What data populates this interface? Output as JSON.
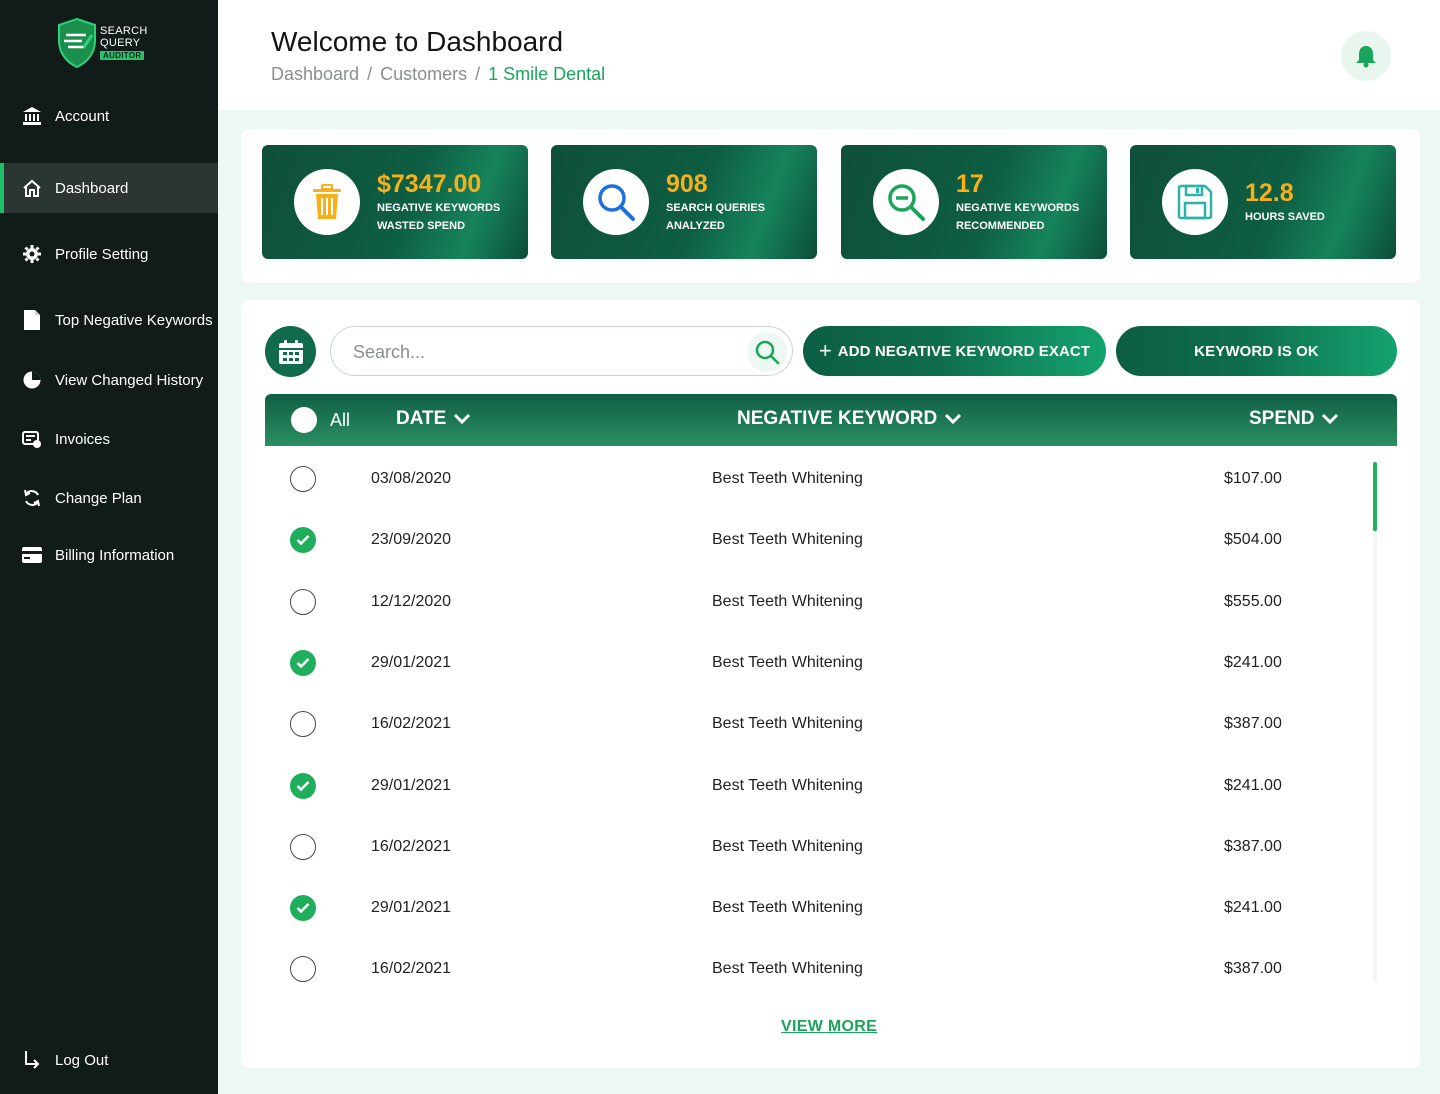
{
  "brand": {
    "line1": "SEARCH",
    "line2": "QUERY",
    "badge": "AUDITOR"
  },
  "sidebar": {
    "items": [
      {
        "label": "Account",
        "icon": "bank-icon"
      },
      {
        "label": "Dashboard",
        "icon": "home-icon",
        "active": true
      },
      {
        "label": "Profile Setting",
        "icon": "gear-icon"
      },
      {
        "label": "Top Negative Keywords",
        "icon": "document-icon"
      },
      {
        "label": "View Changed History",
        "icon": "pie-chart-icon"
      },
      {
        "label": "Invoices",
        "icon": "invoice-icon"
      },
      {
        "label": "Change Plan",
        "icon": "refresh-icon"
      },
      {
        "label": "Billing Information",
        "icon": "credit-card-icon"
      }
    ],
    "logout": "Log Out"
  },
  "header": {
    "title": "Welcome to Dashboard",
    "breadcrumb": [
      "Dashboard",
      "Customers",
      "1 Smile Dental"
    ],
    "separator": "/"
  },
  "stats": [
    {
      "value": "$7347.00",
      "label": "NEGATIVE KEYWORDS WASTED SPEND",
      "icon": "trash-icon",
      "icon_color": "#f7b01a"
    },
    {
      "value": "908",
      "label": "SEARCH QUERIES ANALYZED",
      "icon": "search-icon",
      "icon_color": "#1e6fd9"
    },
    {
      "value": "17",
      "label": "NEGATIVE KEYWORDS RECOMMENDED",
      "icon": "zoom-out-icon",
      "icon_color": "#1aa55a"
    },
    {
      "value": "12.8",
      "label": "HOURS SAVED",
      "icon": "save-icon",
      "icon_color": "#2ab3a6"
    }
  ],
  "toolbar": {
    "search_placeholder": "Search...",
    "add_button": "ADD NEGATIVE KEYWORD EXACT",
    "ok_button": "KEYWORD IS OK"
  },
  "table": {
    "all_label": "All",
    "columns": [
      "DATE",
      "NEGATIVE KEYWORD",
      "SPEND"
    ],
    "rows": [
      {
        "checked": false,
        "date": "03/08/2020",
        "keyword": "Best Teeth Whitening",
        "spend": "$107.00"
      },
      {
        "checked": true,
        "date": "23/09/2020",
        "keyword": "Best Teeth Whitening",
        "spend": "$504.00"
      },
      {
        "checked": false,
        "date": "12/12/2020",
        "keyword": "Best Teeth Whitening",
        "spend": "$555.00"
      },
      {
        "checked": true,
        "date": "29/01/2021",
        "keyword": "Best Teeth Whitening",
        "spend": "$241.00"
      },
      {
        "checked": false,
        "date": "16/02/2021",
        "keyword": "Best Teeth Whitening",
        "spend": "$387.00"
      },
      {
        "checked": true,
        "date": "29/01/2021",
        "keyword": "Best Teeth Whitening",
        "spend": "$241.00"
      },
      {
        "checked": false,
        "date": "16/02/2021",
        "keyword": "Best Teeth Whitening",
        "spend": "$387.00"
      },
      {
        "checked": true,
        "date": "29/01/2021",
        "keyword": "Best Teeth Whitening",
        "spend": "$241.00"
      },
      {
        "checked": false,
        "date": "16/02/2021",
        "keyword": "Best Teeth Whitening",
        "spend": "$387.00"
      }
    ],
    "view_more": "VIEW MORE"
  },
  "colors": {
    "sidebar_bg": "#111c1a",
    "accent_green": "#1aa55a",
    "dark_green": "#0f5f43",
    "stat_value": "#f7b01a"
  }
}
